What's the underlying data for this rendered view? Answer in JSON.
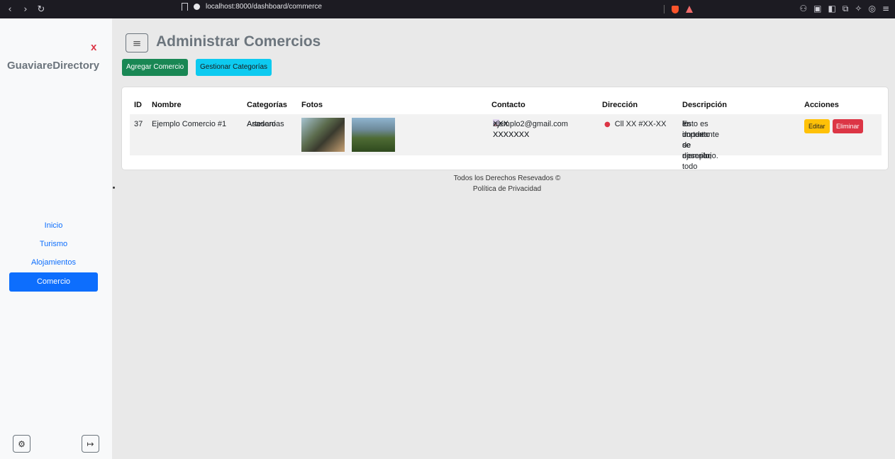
{
  "browser": {
    "url": "localhost:8000/dashboard/commerce"
  },
  "sidebar": {
    "close_label": "x",
    "brand": "GuaviareDirectory",
    "items": [
      {
        "label": "Inicio"
      },
      {
        "label": "Turismo"
      },
      {
        "label": "Alojamientos"
      },
      {
        "label": "Comercio",
        "active": true
      }
    ]
  },
  "header": {
    "title": "Administrar Comercios",
    "add_button": "Agregar Comercio",
    "categories_button": "Gestionar Categorías"
  },
  "table": {
    "columns": [
      "ID",
      "Nombre",
      "Categorías",
      "Fotos",
      "Contacto",
      "Dirección",
      "Descripción",
      "Acciones"
    ],
    "rows": [
      {
        "id": "37",
        "name": "Ejemplo Comercio #1",
        "categories": [
          "Artesanías",
          "Asadero"
        ],
        "phone": "XXX XXXXXXX",
        "email": "ejemplo2@gmail.com",
        "whatsapp": "XXX XXXXXXX",
        "address": "Cll XX #XX-XX",
        "description": [
          "Esto es un texto de ejemplo,",
          "en donde se describe todo",
          "lo importante o necesario."
        ],
        "edit_label": "Editar",
        "delete_label": "Eliminar"
      }
    ]
  },
  "footer": {
    "rights": "Todos los Derechos Resevados ©",
    "privacy": "Política de Privacidad"
  }
}
